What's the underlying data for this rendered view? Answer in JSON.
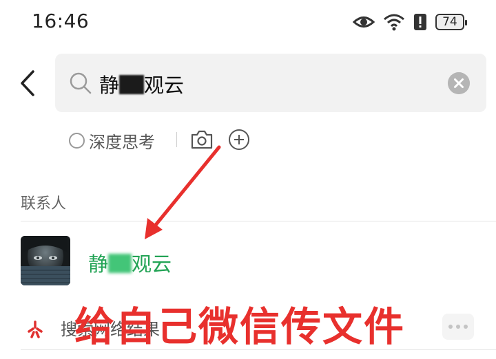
{
  "status_bar": {
    "time": "16:46",
    "battery": "74"
  },
  "search": {
    "query_prefix": "静",
    "query_suffix": "观云"
  },
  "toolbar": {
    "deep_think_label": "深度思考"
  },
  "contacts": {
    "section_label": "联系人",
    "items": [
      {
        "name_prefix": "静",
        "name_suffix": "观云"
      }
    ]
  },
  "web_search": {
    "label": "搜索网络结果"
  },
  "annotation": {
    "caption": "给自己微信传文件",
    "color": "#e8302d"
  },
  "colors": {
    "accent_green": "#22a355",
    "search_bg": "#f2f2f2"
  },
  "icons": [
    "eye-icon",
    "wifi-icon",
    "alert-icon",
    "battery-icon",
    "back-arrow-icon",
    "search-icon",
    "clear-icon",
    "camera-icon",
    "add-icon",
    "web-search-icon",
    "more-icon"
  ]
}
